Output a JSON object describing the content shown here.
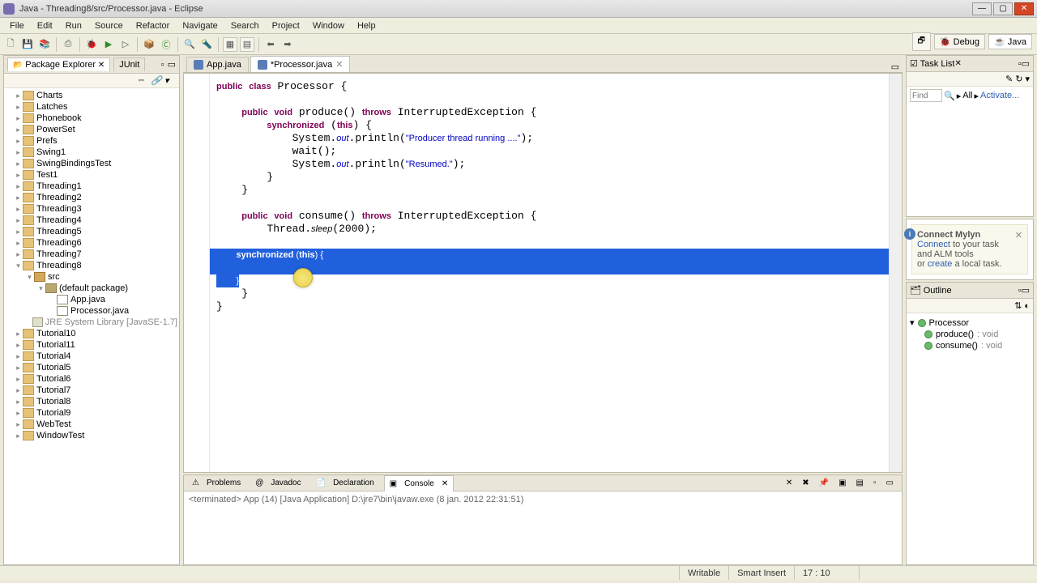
{
  "window": {
    "title": "Java - Threading8/src/Processor.java - Eclipse"
  },
  "menu": [
    "File",
    "Edit",
    "Run",
    "Source",
    "Refactor",
    "Navigate",
    "Search",
    "Project",
    "Window",
    "Help"
  ],
  "perspective": {
    "debug": "Debug",
    "java": "Java"
  },
  "packageExplorer": {
    "title": "Package Explorer",
    "junit": "JUnit",
    "items": [
      {
        "label": "Charts",
        "depth": 1,
        "icon": "fold"
      },
      {
        "label": "Latches",
        "depth": 1,
        "icon": "fold"
      },
      {
        "label": "Phonebook",
        "depth": 1,
        "icon": "fold"
      },
      {
        "label": "PowerSet",
        "depth": 1,
        "icon": "fold"
      },
      {
        "label": "Prefs",
        "depth": 1,
        "icon": "fold"
      },
      {
        "label": "Swing1",
        "depth": 1,
        "icon": "fold"
      },
      {
        "label": "SwingBindingsTest",
        "depth": 1,
        "icon": "fold"
      },
      {
        "label": "Test1",
        "depth": 1,
        "icon": "fold"
      },
      {
        "label": "Threading1",
        "depth": 1,
        "icon": "fold"
      },
      {
        "label": "Threading2",
        "depth": 1,
        "icon": "fold"
      },
      {
        "label": "Threading3",
        "depth": 1,
        "icon": "fold"
      },
      {
        "label": "Threading4",
        "depth": 1,
        "icon": "fold"
      },
      {
        "label": "Threading5",
        "depth": 1,
        "icon": "fold"
      },
      {
        "label": "Threading6",
        "depth": 1,
        "icon": "fold"
      },
      {
        "label": "Threading7",
        "depth": 1,
        "icon": "fold"
      },
      {
        "label": "Threading8",
        "depth": 1,
        "icon": "fold",
        "open": true
      },
      {
        "label": "src",
        "depth": 2,
        "icon": "src",
        "open": true
      },
      {
        "label": "(default package)",
        "depth": 3,
        "icon": "pkg",
        "open": true
      },
      {
        "label": "App.java",
        "depth": 4,
        "icon": "ju"
      },
      {
        "label": "Processor.java",
        "depth": 4,
        "icon": "ju"
      },
      {
        "label": "JRE System Library [JavaSE-1.7]",
        "depth": 2,
        "icon": "lib",
        "lib": true
      },
      {
        "label": "Tutorial10",
        "depth": 1,
        "icon": "fold"
      },
      {
        "label": "Tutorial11",
        "depth": 1,
        "icon": "fold"
      },
      {
        "label": "Tutorial4",
        "depth": 1,
        "icon": "fold"
      },
      {
        "label": "Tutorial5",
        "depth": 1,
        "icon": "fold"
      },
      {
        "label": "Tutorial6",
        "depth": 1,
        "icon": "fold"
      },
      {
        "label": "Tutorial7",
        "depth": 1,
        "icon": "fold"
      },
      {
        "label": "Tutorial8",
        "depth": 1,
        "icon": "fold"
      },
      {
        "label": "Tutorial9",
        "depth": 1,
        "icon": "fold"
      },
      {
        "label": "WebTest",
        "depth": 1,
        "icon": "fold"
      },
      {
        "label": "WindowTest",
        "depth": 1,
        "icon": "fold"
      }
    ]
  },
  "editorTabs": [
    {
      "label": "App.java",
      "active": false
    },
    {
      "label": "*Processor.java",
      "active": true
    }
  ],
  "code": {
    "l1": "public class Processor {",
    "l2": "    public void produce() throws InterruptedException {",
    "l3": "        synchronized (this) {",
    "l4a": "            System.",
    "l4b": "out",
    "l4c": ".println(",
    "l4d": "\"Producer thread running ....\"",
    "l4e": ");",
    "l5": "            wait();",
    "l6a": "            System.",
    "l6b": "out",
    "l6c": ".println(",
    "l6d": "\"Resumed.\"",
    "l6e": ");",
    "l7": "        }",
    "l8": "    }",
    "l9": "    public void consume() throws InterruptedException {",
    "l10a": "        Thread.",
    "l10b": "sleep",
    "l10c": "(2000);",
    "l11": "        synchronized (this) {",
    "l12": "        }",
    "l13": "    }",
    "l14": "}"
  },
  "bottomTabs": {
    "problems": "Problems",
    "javadoc": "Javadoc",
    "declaration": "Declaration",
    "console": "Console"
  },
  "console": {
    "status": "<terminated> App (14) [Java Application] D:\\jre7\\bin\\javaw.exe (8 jan. 2012 22:31:51)"
  },
  "taskList": {
    "title": "Task List",
    "find": "Find",
    "all": "All",
    "activate": "Activate..."
  },
  "mylyn": {
    "title": "Connect Mylyn",
    "line1a": "Connect",
    "line1b": " to your task and ALM tools",
    "line2a": "or ",
    "line2b": "create",
    "line2c": " a local task."
  },
  "outline": {
    "title": "Outline",
    "cls": "Processor",
    "m1": "produce()",
    "m1t": " : void",
    "m2": "consume()",
    "m2t": " : void"
  },
  "status": {
    "writable": "Writable",
    "insert": "Smart Insert",
    "pos": "17 : 10"
  }
}
